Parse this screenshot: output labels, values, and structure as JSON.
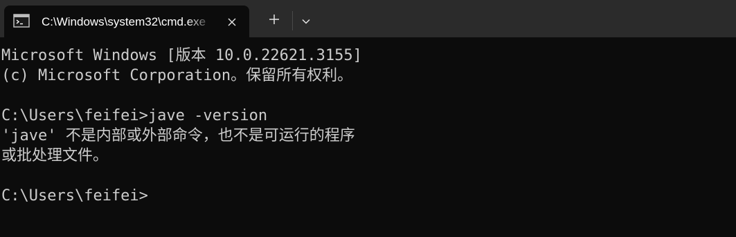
{
  "tab": {
    "title": "C:\\Windows\\system32\\cmd.exe",
    "icon": "terminal-icon"
  },
  "icons": {
    "close": "close-icon",
    "new_tab": "plus-icon",
    "dropdown": "chevron-down-icon"
  },
  "colors": {
    "titlebar_bg": "#2b2b2b",
    "console_bg": "#0c0c0c",
    "console_text": "#cccccc"
  },
  "console": {
    "lines": [
      "Microsoft Windows [版本 10.0.22621.3155]",
      "(c) Microsoft Corporation。保留所有权利。",
      "",
      "C:\\Users\\feifei>jave -version",
      "'jave' 不是内部或外部命令，也不是可运行的程序",
      "或批处理文件。",
      "",
      "C:\\Users\\feifei>"
    ]
  }
}
